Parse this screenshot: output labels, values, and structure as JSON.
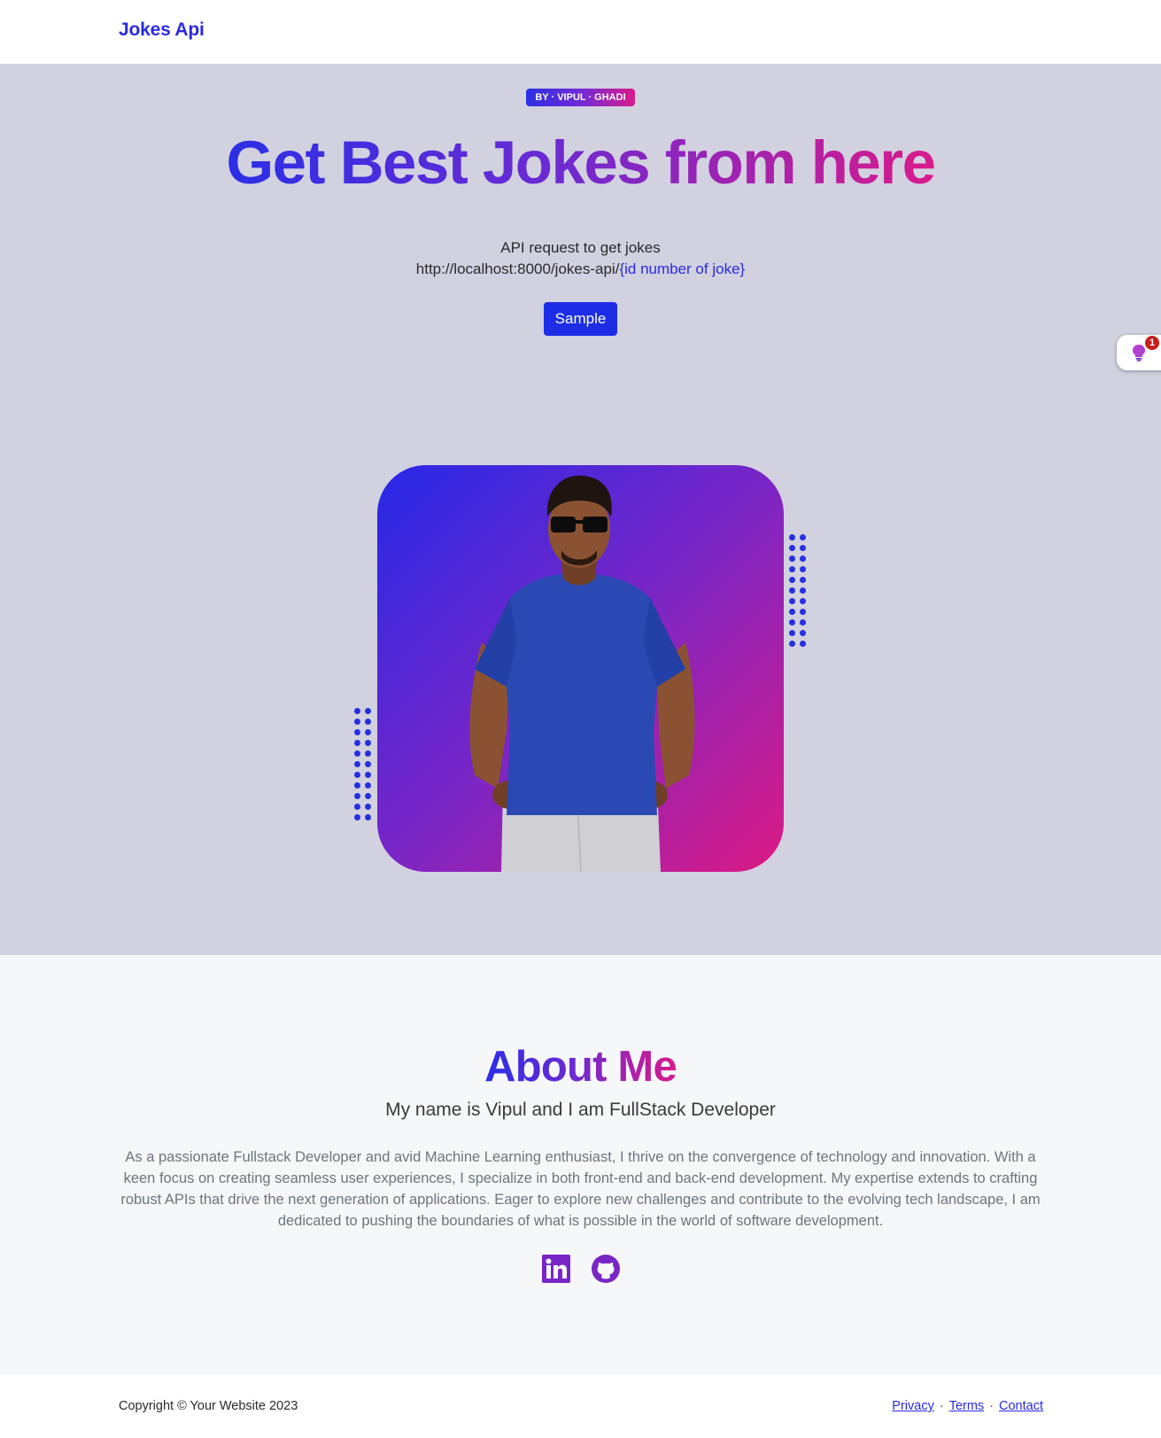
{
  "navbar": {
    "brand": "Jokes Api"
  },
  "hero": {
    "badge": "BY · VIPUL · GHADI",
    "title": "Get Best Jokes from here",
    "api_label": "API request to get jokes",
    "api_url_prefix": "http://localhost:8000/jokes-api/",
    "api_url_param": "{id number of joke}",
    "sample_button": "Sample",
    "photo_alt": "Vipul Ghadi portrait"
  },
  "widget": {
    "count": "1",
    "icon": "lightbulb-icon"
  },
  "about": {
    "title": "About Me",
    "subtitle": "My name is Vipul and I am FullStack Developer",
    "text": "As a passionate Fullstack Developer and avid Machine Learning enthusiast, I thrive on the convergence of technology and innovation. With a keen focus on creating seamless user experiences, I specialize in both front-end and back-end development. My expertise extends to crafting robust APIs that drive the next generation of applications. Eager to explore new challenges and contribute to the evolving tech landscape, I am dedicated to pushing the boundaries of what is possible in the world of software development.",
    "social": [
      {
        "icon": "linkedin-icon"
      },
      {
        "icon": "github-icon"
      }
    ]
  },
  "footer": {
    "copyright": "Copyright © Your Website 2023",
    "links": [
      "Privacy",
      "Terms",
      "Contact"
    ]
  },
  "colors": {
    "brand": "#2a2ae0",
    "hero_bg": "#d2d1e0",
    "gradient_start": "#2b2fe6",
    "gradient_end": "#d91b8c",
    "button": "#1d2de6"
  }
}
